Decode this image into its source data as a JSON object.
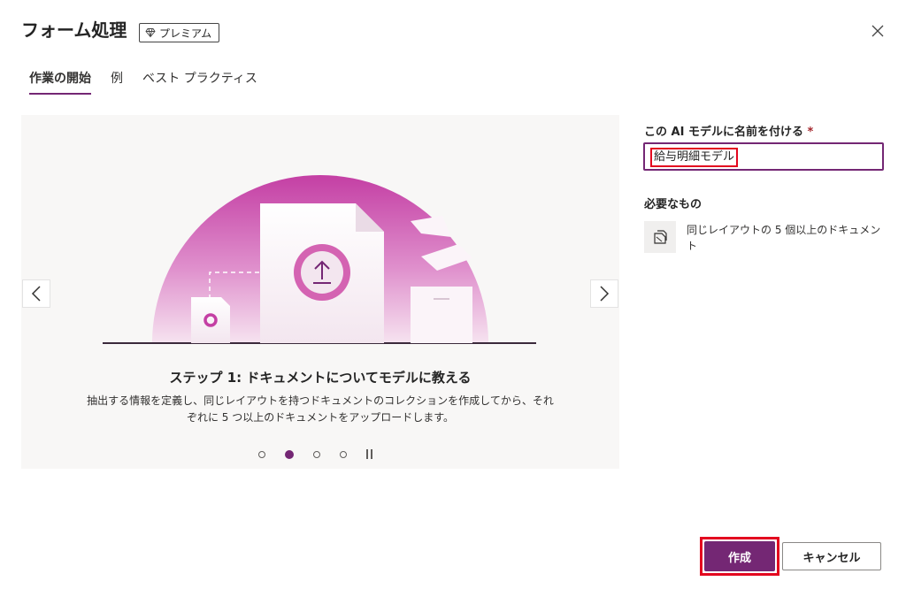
{
  "header": {
    "title": "フォーム処理",
    "premium_badge": "プレミアム",
    "close_icon": "close-icon"
  },
  "tabs": [
    {
      "label": "作業の開始",
      "active": true
    },
    {
      "label": "例",
      "active": false
    },
    {
      "label": "ベスト プラクティス",
      "active": false
    }
  ],
  "carousel": {
    "step_title": "ステップ 1: ドキュメントについてモデルに教える",
    "step_description": "抽出する情報を定義し、同じレイアウトを持つドキュメントのコレクションを作成してから、それぞれに 5 つ以上のドキュメントをアップロードします。",
    "slide_count": 4,
    "active_slide": 2,
    "prev_icon": "chevron-left-icon",
    "next_icon": "chevron-right-icon",
    "pause_icon": "pause-icon"
  },
  "form": {
    "name_label": "この AI モデルに名前を付ける",
    "required_mark": "*",
    "name_value": "給与明細モデル"
  },
  "requirements": {
    "heading": "必要なもの",
    "item_text": "同じレイアウトの 5 個以上のドキュメント",
    "item_icon": "document-icon"
  },
  "footer": {
    "create_label": "作成",
    "cancel_label": "キャンセル"
  },
  "colors": {
    "accent": "#742774",
    "highlight": "#e3061f",
    "illustration_pink": "#c43fa4"
  }
}
